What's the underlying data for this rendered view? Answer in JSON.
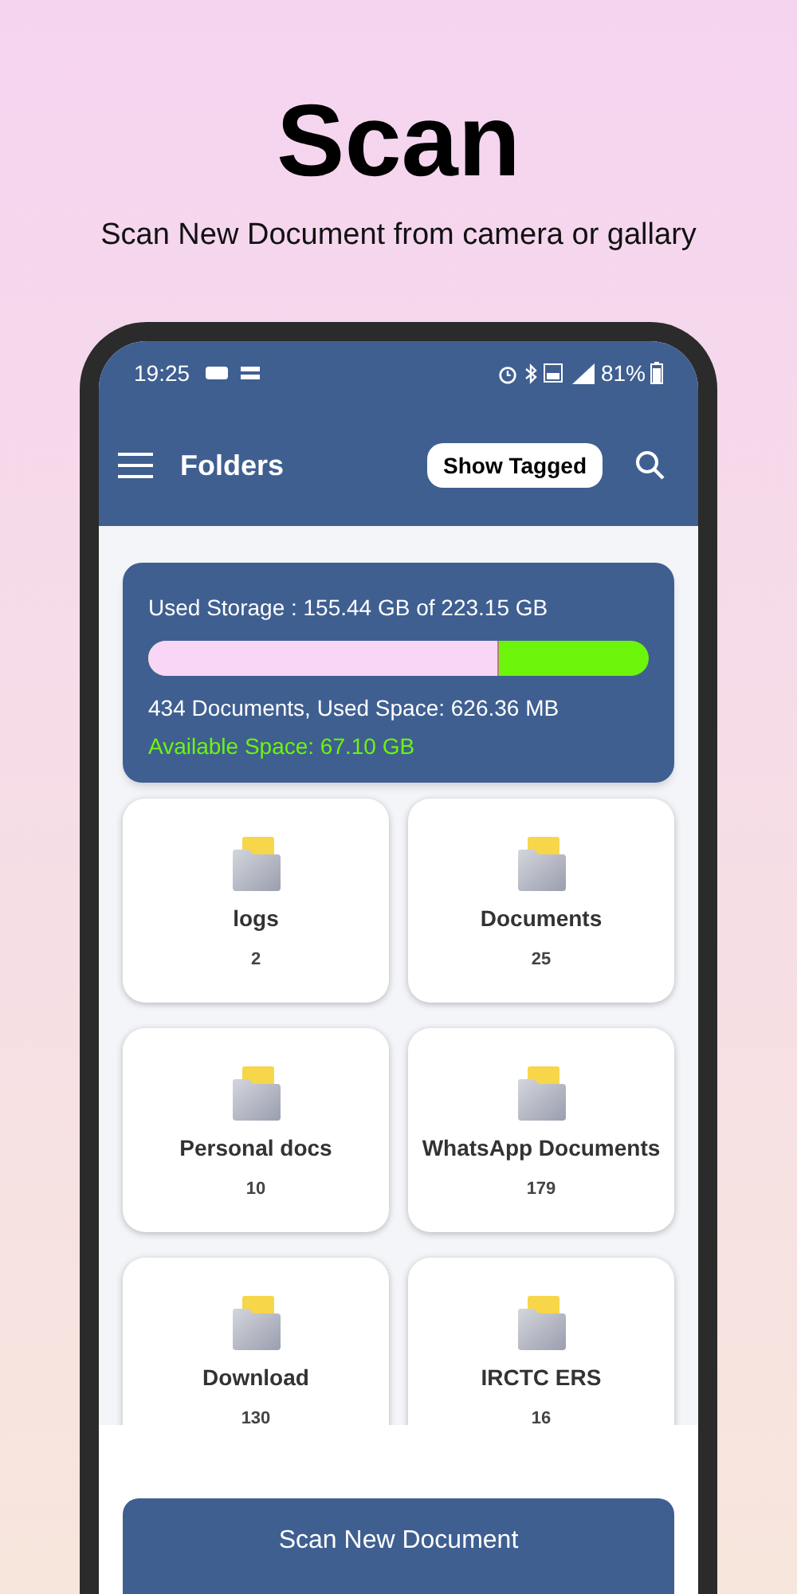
{
  "headline": "Scan",
  "subtitle": "Scan New Document from camera or gallary",
  "status_bar": {
    "time": "19:25",
    "battery": "81%"
  },
  "toolbar": {
    "title": "Folders",
    "tagged_button": "Show Tagged"
  },
  "storage": {
    "used": "Used Storage :  155.44 GB of 223.15 GB",
    "level": 0.7,
    "documents": "434 Documents, Used Space: 626.36 MB",
    "available": "Available Space: 67.10 GB"
  },
  "folders": [
    {
      "name": "logs",
      "count": "2"
    },
    {
      "name": "Documents",
      "count": "25"
    },
    {
      "name": "Personal docs",
      "count": "10"
    },
    {
      "name": "WhatsApp Documents",
      "count": "179"
    },
    {
      "name": "Download",
      "count": "130"
    },
    {
      "name": "IRCTC ERS",
      "count": "16"
    }
  ],
  "scan_button": "Scan New Document"
}
